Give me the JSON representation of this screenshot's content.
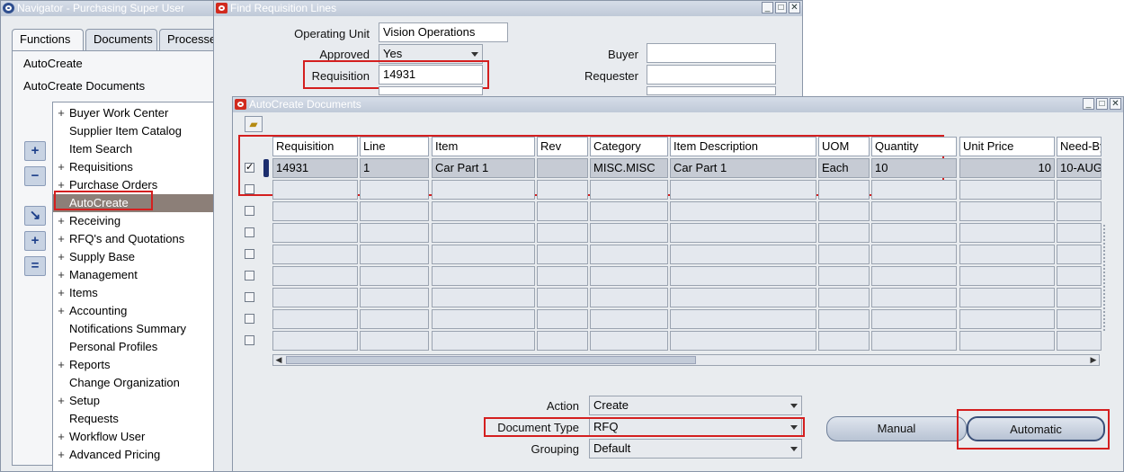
{
  "navigator": {
    "title": "Navigator - Purchasing Super User",
    "tabs": [
      "Functions",
      "Documents",
      "Processes"
    ],
    "top_items": [
      "AutoCreate",
      "AutoCreate Documents"
    ],
    "tree": [
      {
        "prefix": "+",
        "label": "Buyer Work Center"
      },
      {
        "prefix": "",
        "label": "Supplier Item Catalog"
      },
      {
        "prefix": "",
        "label": "Item Search"
      },
      {
        "prefix": "+",
        "label": "Requisitions"
      },
      {
        "prefix": "+",
        "label": "Purchase Orders"
      },
      {
        "prefix": "",
        "label": "AutoCreate"
      },
      {
        "prefix": "+",
        "label": "Receiving"
      },
      {
        "prefix": "+",
        "label": "RFQ's and Quotations"
      },
      {
        "prefix": "+",
        "label": "Supply Base"
      },
      {
        "prefix": "+",
        "label": "Management"
      },
      {
        "prefix": "+",
        "label": "Items"
      },
      {
        "prefix": "+",
        "label": "Accounting"
      },
      {
        "prefix": "",
        "label": "Notifications Summary"
      },
      {
        "prefix": "",
        "label": "Personal Profiles"
      },
      {
        "prefix": "+",
        "label": "Reports"
      },
      {
        "prefix": "",
        "label": "Change Organization"
      },
      {
        "prefix": "+",
        "label": "Setup"
      },
      {
        "prefix": "",
        "label": "Requests"
      },
      {
        "prefix": "+",
        "label": "Workflow User"
      },
      {
        "prefix": "+",
        "label": "Advanced Pricing"
      }
    ],
    "side_buttons": [
      "+",
      "−",
      "↘",
      "+",
      "="
    ]
  },
  "find_req": {
    "title": "Find Requisition Lines",
    "operating_unit_label": "Operating Unit",
    "operating_unit_value": "Vision Operations",
    "approved_label": "Approved",
    "approved_value": "Yes",
    "requisition_label": "Requisition",
    "requisition_value": "14931",
    "buyer_label": "Buyer",
    "requester_label": "Requester"
  },
  "autocreate": {
    "title": "AutoCreate Documents",
    "columns": [
      "Requisition",
      "Line",
      "Item",
      "Rev",
      "Category",
      "Item Description",
      "UOM",
      "Quantity",
      "Unit Price",
      "Need-By"
    ],
    "row": {
      "requisition": "14931",
      "line": "1",
      "item": "Car Part 1",
      "rev": "",
      "category": "MISC.MISC",
      "description": "Car Part 1",
      "uom": "Each",
      "quantity": "10",
      "unit_price": "10",
      "need_by": "10-AUG"
    },
    "action_label": "Action",
    "action_value": "Create",
    "doc_type_label": "Document Type",
    "doc_type_value": "RFQ",
    "grouping_label": "Grouping",
    "grouping_value": "Default",
    "manual_button": "Manual",
    "automatic_button": "Automatic"
  },
  "colors": {
    "highlight": "#d41f1f",
    "selected_tree": "#8c7f78"
  }
}
